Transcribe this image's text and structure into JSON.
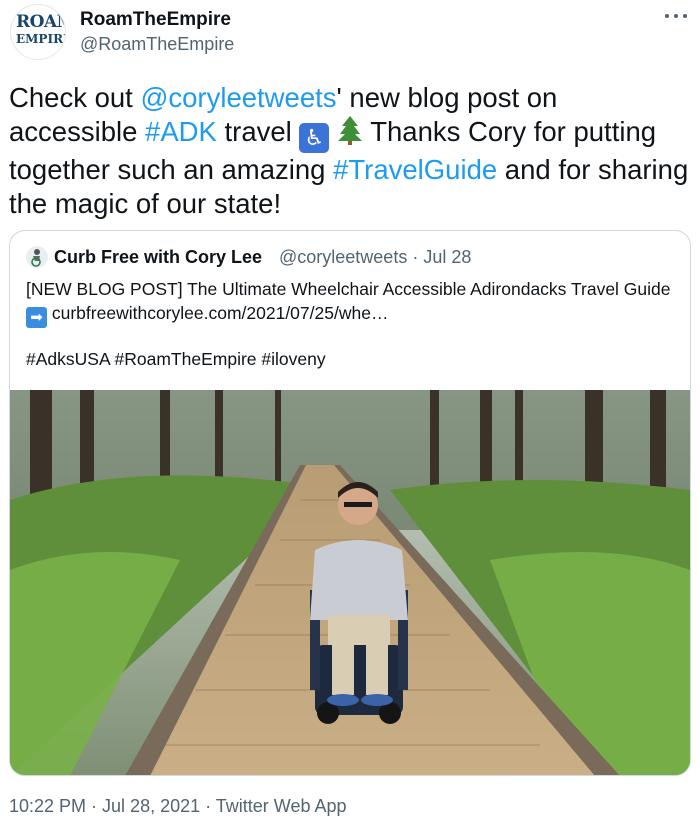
{
  "account": {
    "display_name": "RoamTheEmpire",
    "handle": "@RoamTheEmpire",
    "avatar_line1": "ROAM",
    "avatar_line2": "EMPIRE"
  },
  "more_icon": "more-horizontal-icon",
  "tweet": {
    "p1": "Check out ",
    "mention": "@coryleetweets",
    "p2": "' new blog post on accessible ",
    "hashtag1": "#ADK",
    "p3": " travel ",
    "emoji1": "wheelchair-symbol-emoji",
    "emoji2": "evergreen-tree-emoji",
    "p4": " Thanks Cory for putting together such an amazing ",
    "hashtag2": "#TravelGuide",
    "p5": " and for sharing the magic of our state!"
  },
  "quoted": {
    "name": "Curb Free with Cory Lee",
    "handle_date": "@coryleetweets · Jul 28",
    "text": "[NEW BLOG POST] The Ultimate Wheelchair Accessible Adirondacks Travel Guide ",
    "arrow_emoji": "right-arrow-emoji",
    "link": "curbfreewithcorylee.com/2021/07/25/whe…",
    "tags": "#AdksUSA #RoamTheEmpire #iloveny",
    "photo": "man-in-wheelchair-on-forest-boardwalk-photo"
  },
  "meta": "10:22 PM · Jul 28, 2021 · Twitter Web App",
  "colors": {
    "link": "#1d9bf0",
    "secondary_text": "#536471",
    "primary_text": "#0f1419",
    "border": "#cfd9de"
  }
}
